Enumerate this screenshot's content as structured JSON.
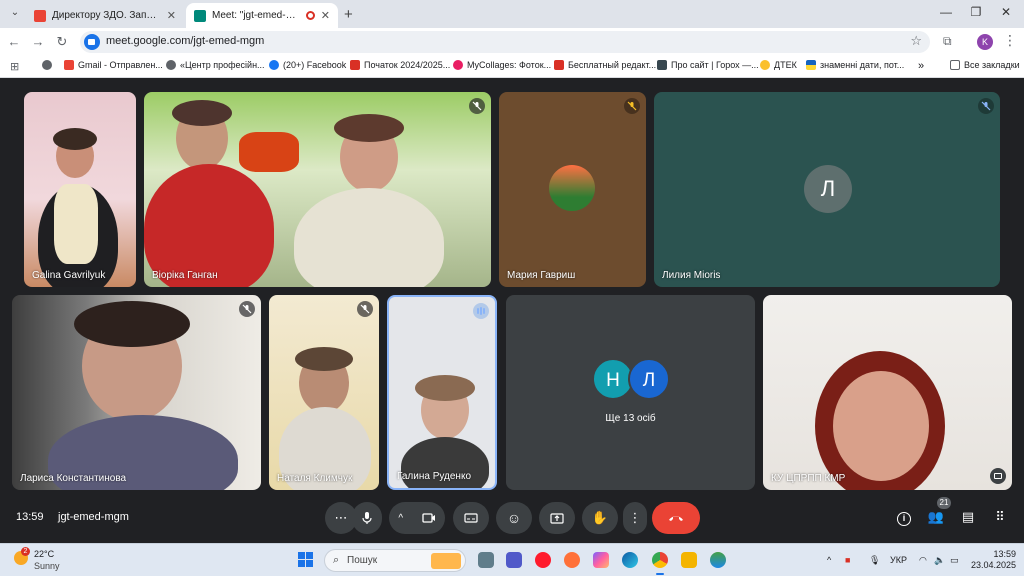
{
  "browser": {
    "tabs": [
      {
        "title": "Директору ЗДО. Запрошення",
        "close": "✕"
      },
      {
        "title": "Meet: \"jgt-emed-mgm\"",
        "close": "✕"
      }
    ],
    "new_tab": "+",
    "window_controls": [
      "—",
      "❐",
      "✕"
    ],
    "url": "meet.google.com/jgt-emed-mgm",
    "profile_initial": "K",
    "bookmarks": [
      {
        "label": "Gmail - Отправлен...",
        "color": "#ea4335"
      },
      {
        "label": "«Центр професійн...",
        "color": "#5f6368"
      },
      {
        "label": "(20+) Facebook",
        "color": "#1877f2"
      },
      {
        "label": "Початок 2024/2025...",
        "color": "#d93025"
      },
      {
        "label": "MyCollages: Фоток...",
        "color": "#e91e63"
      },
      {
        "label": "Бесплатный редакт...",
        "color": "#d93025"
      },
      {
        "label": "Про сайт | Горох —...",
        "color": "#37474f"
      },
      {
        "label": "ДТЕК",
        "color": "#fbc02d"
      },
      {
        "label": "знаменні дати, пот...",
        "color": "#1565c0"
      }
    ],
    "bookmarks_more": "»",
    "all_bookmarks": "Все закладки"
  },
  "meet": {
    "tiles": [
      {
        "name": "Galina Gavrilyuk",
        "muted": false
      },
      {
        "name": "Віоріка Ганган",
        "muted": true
      },
      {
        "name": "Мария Гавриш",
        "muted": true
      },
      {
        "name": "Лилия Mioris",
        "muted": true,
        "avatar": "Л"
      },
      {
        "name": "Лариса Константинова",
        "muted": true
      },
      {
        "name": "Наталя Климчук",
        "muted": true
      },
      {
        "name": "Галина Руденко",
        "muted": false,
        "speaking": true
      },
      {
        "name": "",
        "more_label": "Ще 13 осіб",
        "avatars": [
          "Н",
          "Л"
        ]
      },
      {
        "name": "КУ ЦПРПП КМР",
        "muted": false
      }
    ],
    "controls": {
      "time": "13:59",
      "meeting_code": "jgt-emed-mgm",
      "participants_count": "21",
      "end_call_color": "#ea4335"
    }
  },
  "taskbar": {
    "temperature": "22°C",
    "condition": "Sunny",
    "weather_badge": "2",
    "search_placeholder": "Пошук",
    "language": "УКР",
    "time": "13:59",
    "date": "23.04.2025"
  }
}
